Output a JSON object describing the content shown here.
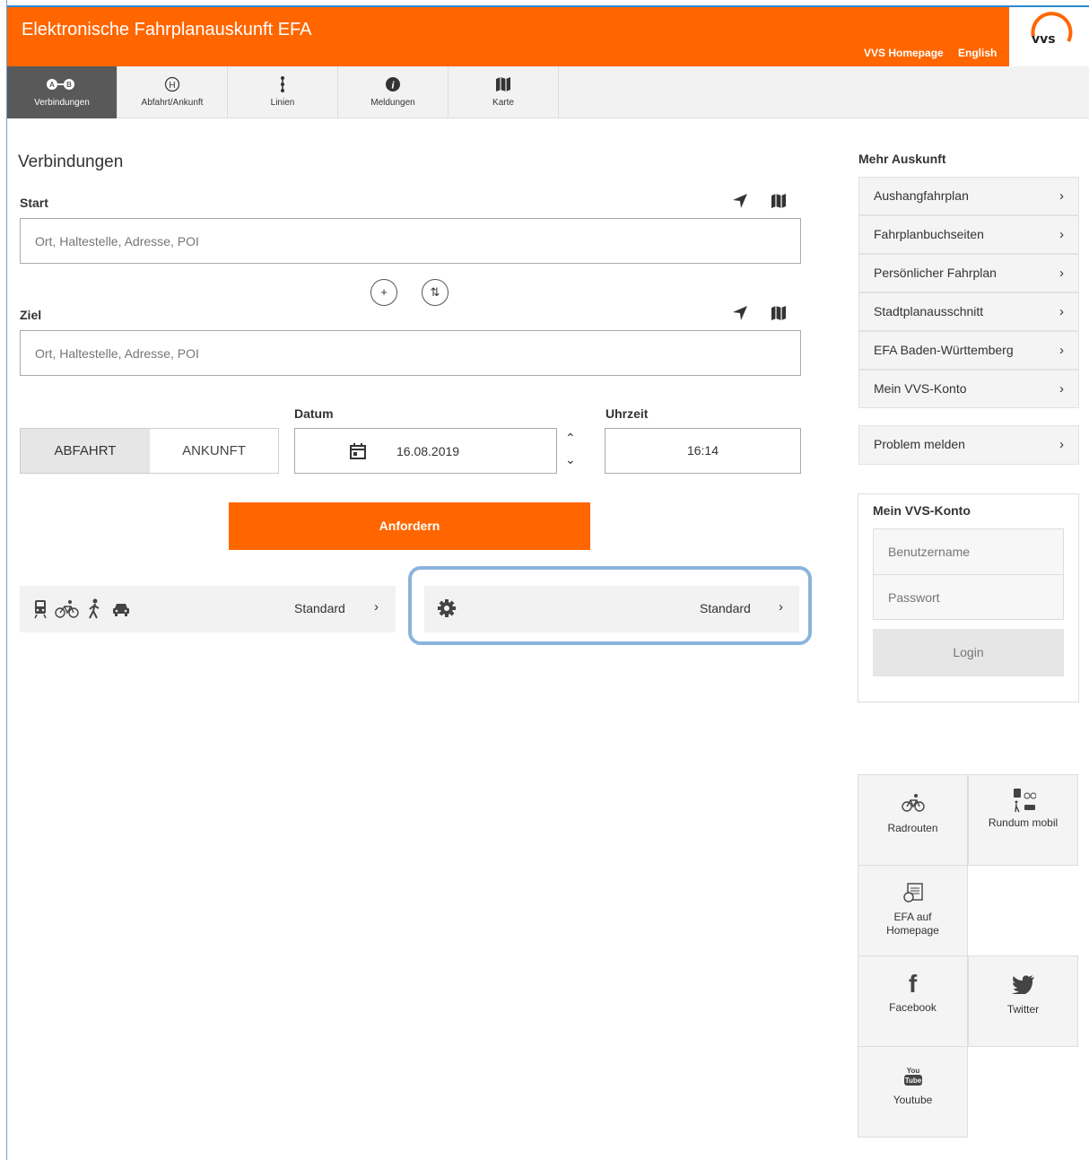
{
  "header": {
    "title": "Elektronische Fahrplanauskunft EFA",
    "links": [
      "VVS Homepage",
      "English"
    ],
    "logo_text": "vvs",
    "accent_color": "#ff6600"
  },
  "tabs": [
    {
      "label": "Verbindungen",
      "icon": "a-to-b-icon",
      "active": true
    },
    {
      "label": "Abfahrt/Ankunft",
      "icon": "stop-h-icon",
      "active": false
    },
    {
      "label": "Linien",
      "icon": "lines-icon",
      "active": false
    },
    {
      "label": "Meldungen",
      "icon": "info-icon",
      "active": false
    },
    {
      "label": "Karte",
      "icon": "map-icon",
      "active": false
    }
  ],
  "form": {
    "title": "Verbindungen",
    "start_label": "Start",
    "start_placeholder": "Ort, Haltestelle, Adresse, POI",
    "ziel_label": "Ziel",
    "ziel_placeholder": "Ort, Haltestelle, Adresse, POI",
    "add_symbol": "+",
    "swap_symbol": "⇅",
    "abfahrt_label": "ABFAHRT",
    "ankunft_label": "ANKUNFT",
    "datum_label": "Datum",
    "datum_value": "16.08.2019",
    "uhrzeit_label": "Uhrzeit",
    "uhrzeit_value": "16:14",
    "submit_label": "Anfordern",
    "transport_value": "Standard",
    "settings_value": "Standard"
  },
  "sidebar": {
    "title": "Mehr Auskunft",
    "items": [
      "Aushangfahrplan",
      "Fahrplanbuchseiten",
      "Persönlicher Fahrplan",
      "Stadtplanausschnitt",
      "EFA Baden-Württemberg",
      "Mein VVS-Konto"
    ],
    "problem_label": "Problem melden",
    "account": {
      "title": "Mein VVS-Konto",
      "username_placeholder": "Benutzername",
      "password_placeholder": "Passwort",
      "login_label": "Login"
    },
    "tiles": [
      {
        "label": "Radrouten",
        "icon": "bicycle-icon"
      },
      {
        "label": "Rundum mobil",
        "icon": "multimodal-icon"
      },
      {
        "label": "EFA auf\nHomepage",
        "icon": "efa-widget-icon"
      },
      {
        "label": "Facebook",
        "icon": "facebook-icon"
      },
      {
        "label": "Twitter",
        "icon": "twitter-icon"
      },
      {
        "label": "Youtube",
        "icon": "youtube-icon"
      }
    ]
  }
}
